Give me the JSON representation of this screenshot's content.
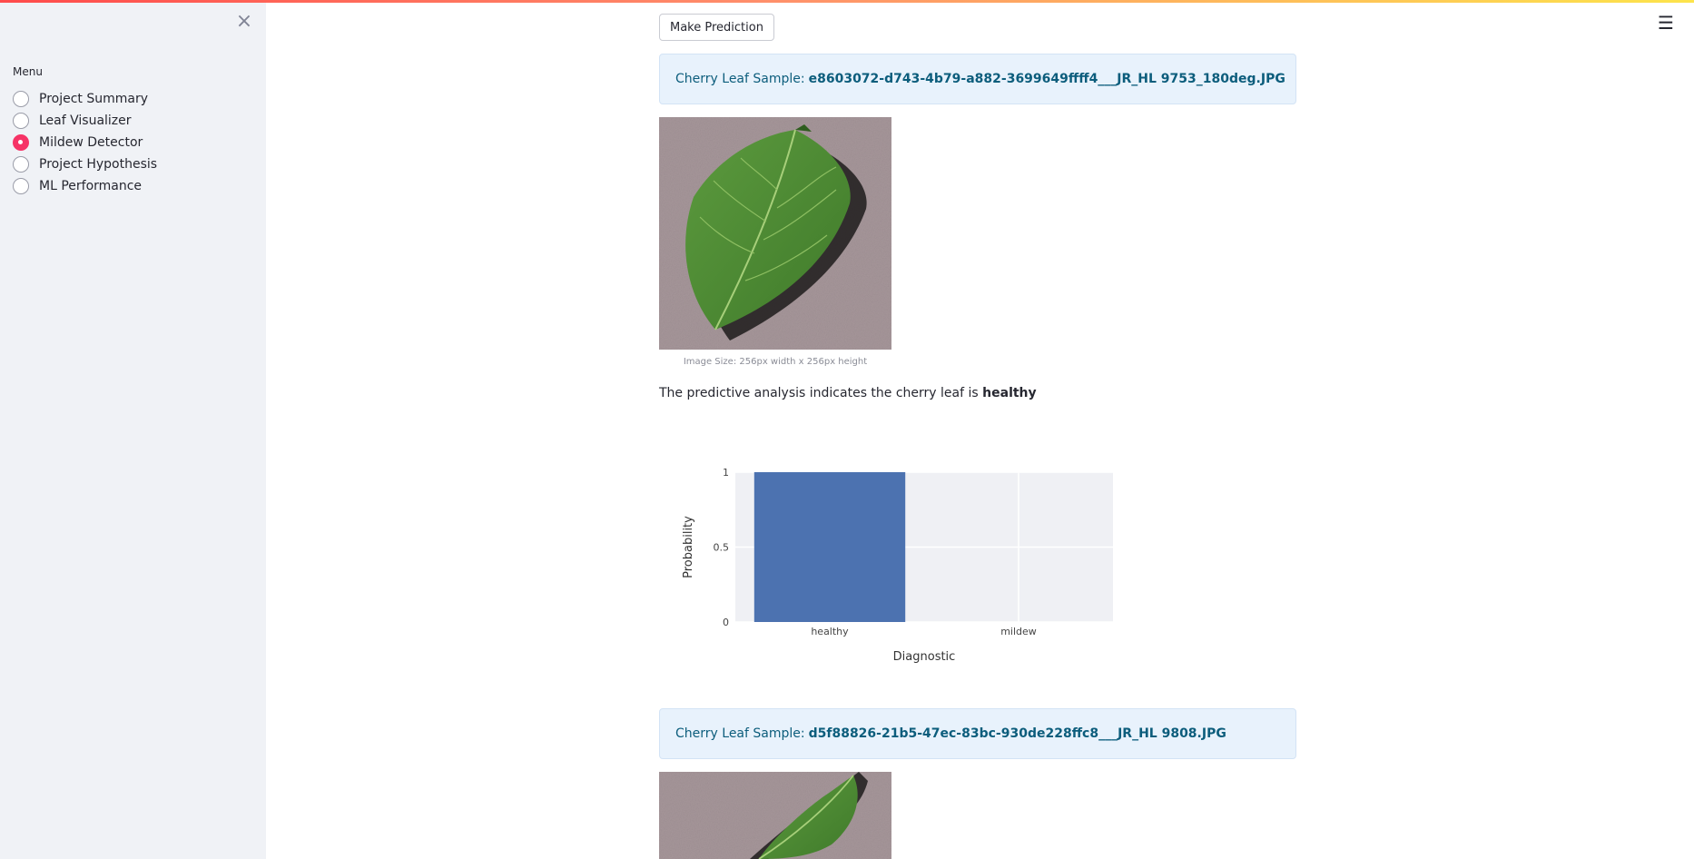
{
  "sidebar": {
    "close_icon": "close-icon",
    "menu_label": "Menu",
    "items": [
      {
        "label": "Project Summary",
        "selected": false
      },
      {
        "label": "Leaf Visualizer",
        "selected": false
      },
      {
        "label": "Mildew Detector",
        "selected": true
      },
      {
        "label": "Project Hypothesis",
        "selected": false
      },
      {
        "label": "ML Performance",
        "selected": false
      }
    ]
  },
  "header": {
    "menu_icon": "hamburger-menu-icon"
  },
  "main": {
    "button_label": "Make Prediction",
    "samples": [
      {
        "prefix": "Cherry Leaf Sample:",
        "filename": "e8603072-d743-4b79-a882-3699649ffff4___JR_HL 9753_180deg.JPG",
        "caption": "Image Size: 256px width x 256px height",
        "verdict_text": "The predictive analysis indicates the cherry leaf is",
        "verdict_label": "healthy"
      },
      {
        "prefix": "Cherry Leaf Sample:",
        "filename": "d5f88826-21b5-47ec-83bc-930de228ffc8___JR_HL 9808.JPG"
      }
    ]
  },
  "colors": {
    "accent": "#f63366",
    "sidebar_bg": "#f0f2f6",
    "info_bg": "#e8f2fc",
    "info_text": "#0c5d7c",
    "bar": "#4c72b0",
    "plot_bg": "#eff0f4"
  },
  "chart_data": {
    "type": "bar",
    "categories": [
      "healthy",
      "mildew"
    ],
    "values": [
      1,
      0
    ],
    "xlabel": "Diagnostic",
    "ylabel": "Probability",
    "ylim": [
      0,
      1
    ],
    "yticks": [
      "0",
      "0.5",
      "1"
    ],
    "grid": true
  }
}
